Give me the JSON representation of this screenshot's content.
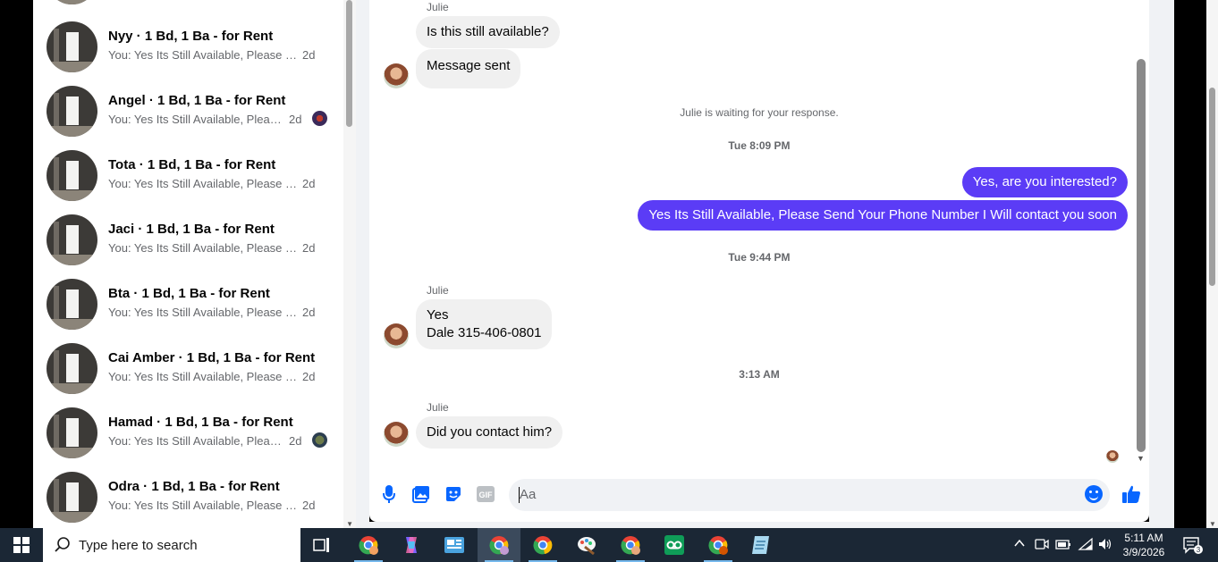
{
  "conversations": [
    {
      "name": "Nyy · 1 Bd, 1 Ba - for Rent",
      "preview": "You: Yes Its Still Available, Please Se...",
      "time": "2d"
    },
    {
      "name": "Angel · 1 Bd, 1 Ba - for Rent",
      "preview": "You: Yes Its Still Available, Please...",
      "time": "2d"
    },
    {
      "name": "Tota · 1 Bd, 1 Ba - for Rent",
      "preview": "You: Yes Its Still Available, Please Se...",
      "time": "2d"
    },
    {
      "name": "Jaci · 1 Bd, 1 Ba - for Rent",
      "preview": "You: Yes Its Still Available, Please Se...",
      "time": "2d"
    },
    {
      "name": "Bta · 1 Bd, 1 Ba - for Rent",
      "preview": "You: Yes Its Still Available, Please Se...",
      "time": "2d"
    },
    {
      "name": "Cai Amber · 1 Bd, 1 Ba - for Rent",
      "preview": "You: Yes Its Still Available, Please Se...",
      "time": "2d"
    },
    {
      "name": "Hamad · 1 Bd, 1 Ba - for Rent",
      "preview": "You: Yes Its Still Available, Please...",
      "time": "2d"
    },
    {
      "name": "Odra · 1 Bd, 1 Ba - for Rent",
      "preview": "You: Yes Its Still Available, Please Se...",
      "time": "2d"
    }
  ],
  "chat": {
    "sender_1": "Julie",
    "msg_1a": "Is this still available?",
    "msg_1b": "Message sent",
    "waiting": "Julie is waiting for your response.",
    "ts_1": "Tue 8:09 PM",
    "out_1": "Yes, are you interested?",
    "out_2": "Yes Its Still Available, Please Send Your Phone Number I Will contact you soon",
    "ts_2": "Tue 9:44 PM",
    "sender_2": "Julie",
    "msg_2_line1": "Yes",
    "msg_2_line2": "Dale 315-406-0801",
    "ts_3": "3:13 AM",
    "sender_3": "Julie",
    "msg_3": "Did you contact him?"
  },
  "composer": {
    "placeholder": "Aa",
    "gif_label": "GIF"
  },
  "taskbar": {
    "search_placeholder": "Type here to search",
    "time": "5:11 AM",
    "date": "3/9/2026",
    "notification_count": "3"
  },
  "colors": {
    "outgoing_bubble": "#5b3cf6",
    "accent": "#0866ff",
    "taskbar": "#1b2735"
  }
}
